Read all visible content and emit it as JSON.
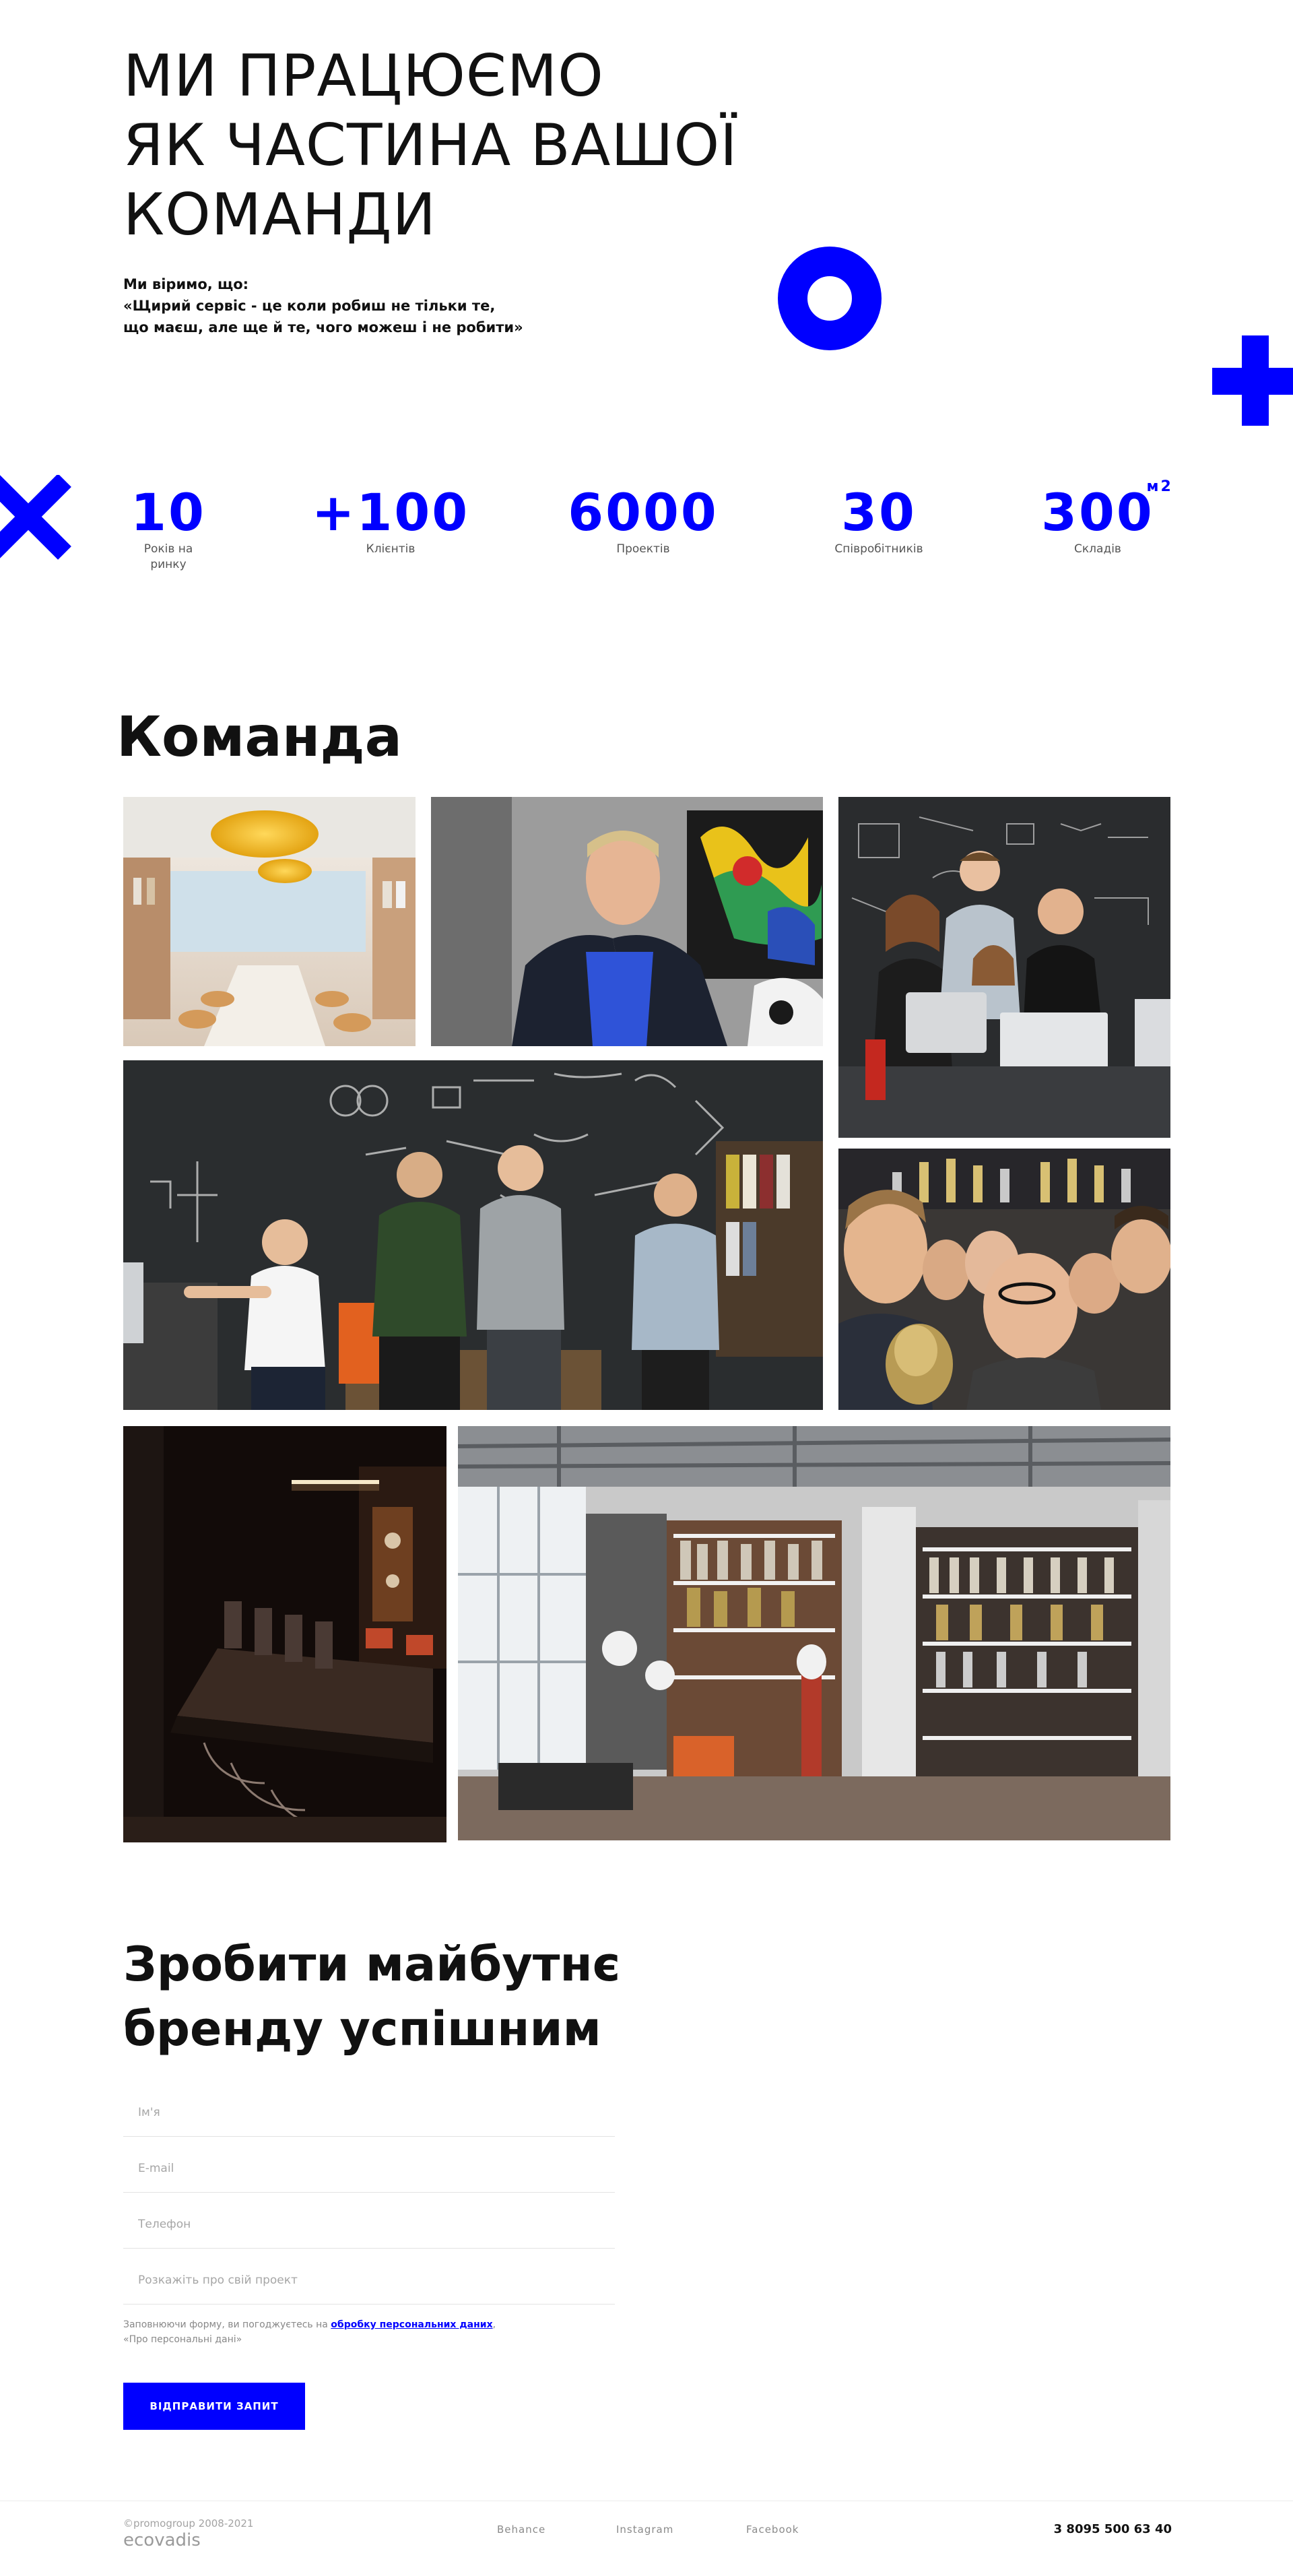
{
  "hero": {
    "title_lines": [
      "МИ ПРАЦЮЄМО",
      "ЯК ЧАСТИНА ВАШОЇ",
      "КОМАНДИ"
    ],
    "subtitle_lines": [
      "Ми віримо, що:",
      "«Щирий сервіс - це коли робиш не тільки те,",
      "що маєш, але ще й те, чого можеш і не робити»"
    ]
  },
  "stats": [
    {
      "value": "10",
      "label_lines": [
        "Років на",
        "ринку"
      ]
    },
    {
      "value": "+100",
      "label_lines": [
        "Клієнтів"
      ]
    },
    {
      "value": "6000",
      "label_lines": [
        "Проектів"
      ]
    },
    {
      "value": "30",
      "label_lines": [
        "Співробітників"
      ]
    },
    {
      "value": "300",
      "sup": "м2",
      "label_lines": [
        "Складів"
      ]
    }
  ],
  "team": {
    "title": "Команда"
  },
  "cta": {
    "title_lines": [
      "Зробити майбутнє",
      "бренду успішним"
    ]
  },
  "form": {
    "name_placeholder": "Ім'я",
    "email_placeholder": "E-mail",
    "phone_placeholder": "Телефон",
    "project_placeholder": "Розкажіть про свій проект",
    "consent_prefix": "Заповнюючи форму, ви погоджуєтесь на ",
    "consent_link": "обробку персональних даних",
    "consent_suffix": ", «Про персональні дані»",
    "submit_label": "ВІДПРАВИТИ ЗАПИТ"
  },
  "footer": {
    "copyright": "©promogroup 2008-2021",
    "logo": "ecovadis",
    "links": [
      "Behance",
      "Instagram",
      "Facebook"
    ],
    "phone": "3 8095 500 63 40"
  },
  "colors": {
    "accent": "#0000ff",
    "text": "#111111",
    "muted": "#888888"
  }
}
